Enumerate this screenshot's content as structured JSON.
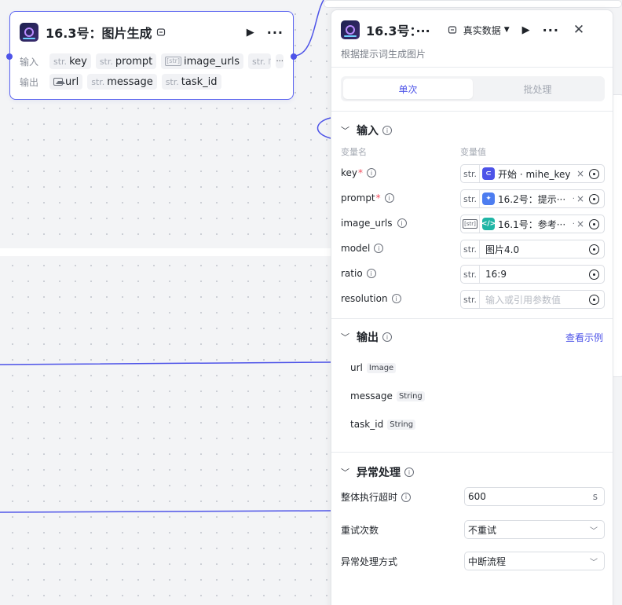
{
  "node": {
    "title": "16.3号：图片生成",
    "inputs_label": "输入",
    "outputs_label": "输出",
    "inputs": [
      {
        "type": "str.",
        "name": "key"
      },
      {
        "type": "str.",
        "name": "prompt"
      },
      {
        "type": "[str]",
        "name": "image_urls"
      },
      {
        "type": "str.",
        "name": "mo"
      }
    ],
    "outputs": [
      {
        "type": "image",
        "name": "url"
      },
      {
        "type": "str.",
        "name": "message"
      },
      {
        "type": "str.",
        "name": "task_id"
      }
    ],
    "more_label": "···"
  },
  "panel": {
    "title": "16.3号：···",
    "data_mode": "真实数据",
    "description": "根据提示词生成图片",
    "tabs": [
      "单次",
      "批处理"
    ],
    "input_section": {
      "label": "输入",
      "col_name": "变量名",
      "col_value": "变量值",
      "params": [
        {
          "name": "key",
          "required": "*",
          "type": "str.",
          "ref_label": "开始 · mihe_key",
          "ref_color": "#4d53e8"
        },
        {
          "name": "prompt",
          "required": "*",
          "type": "str.",
          "ref_label": "16.2号：提示···",
          "ref_color": "#4d7df0"
        },
        {
          "name": "image_urls",
          "required": "",
          "type": "[str]",
          "ref_label": "16.1号：参考···",
          "ref_color": "#1fb5a5"
        },
        {
          "name": "model",
          "required": "",
          "type": "str.",
          "value": "图片4.0"
        },
        {
          "name": "ratio",
          "required": "",
          "type": "str.",
          "value": "16:9"
        },
        {
          "name": "resolution",
          "required": "",
          "type": "str.",
          "placeholder": "输入或引用参数值"
        }
      ]
    },
    "output_section": {
      "label": "输出",
      "link": "查看示例",
      "items": [
        {
          "name": "url",
          "type": "Image"
        },
        {
          "name": "message",
          "type": "String"
        },
        {
          "name": "task_id",
          "type": "String"
        }
      ]
    },
    "error_section": {
      "label": "异常处理",
      "timeout_label": "整体执行超时",
      "timeout_value": "600",
      "timeout_unit": "s",
      "retry_label": "重试次数",
      "retry_value": "不重试",
      "mode_label": "异常处理方式",
      "mode_value": "中断流程"
    }
  },
  "colors": {
    "accent": "#4d53e8",
    "required": "#f2495a"
  }
}
